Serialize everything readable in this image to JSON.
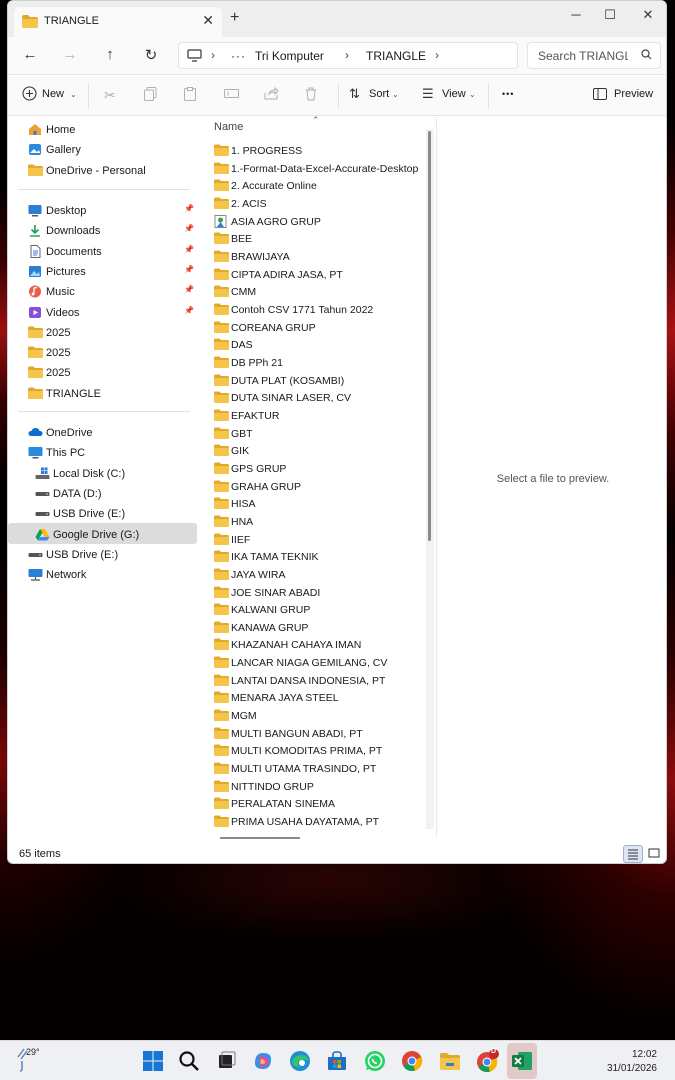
{
  "window": {
    "tab_title": "TRIANGLE",
    "new_tab_symbol": "+"
  },
  "navigation": {
    "breadcrumbs": [
      "Tri Komputer",
      "TRIANGLE"
    ],
    "more_symbol": "···",
    "search_placeholder": "Search TRIANGL"
  },
  "commandbar": {
    "new_label": "New",
    "sort_label": "Sort",
    "view_label": "View",
    "more_symbol": "•••",
    "preview_label": "Preview"
  },
  "sidebar": {
    "top": [
      {
        "label": "Home",
        "icon": "home-icon"
      },
      {
        "label": "Gallery",
        "icon": "gallery-icon"
      },
      {
        "label": "OneDrive - Personal",
        "icon": "folder-icon"
      }
    ],
    "quick_access": [
      {
        "label": "Desktop",
        "icon": "desktop-icon",
        "pinned": true
      },
      {
        "label": "Downloads",
        "icon": "download-icon",
        "pinned": true
      },
      {
        "label": "Documents",
        "icon": "documents-icon",
        "pinned": true
      },
      {
        "label": "Pictures",
        "icon": "pictures-icon",
        "pinned": true
      },
      {
        "label": "Music",
        "icon": "music-icon",
        "pinned": true
      },
      {
        "label": "Videos",
        "icon": "videos-icon",
        "pinned": true
      },
      {
        "label": "2025",
        "icon": "folder-icon",
        "pinned": false
      },
      {
        "label": "2025",
        "icon": "folder-icon",
        "pinned": false
      },
      {
        "label": "2025",
        "icon": "folder-icon",
        "pinned": false
      },
      {
        "label": "TRIANGLE",
        "icon": "folder-icon",
        "pinned": false
      }
    ],
    "tree": [
      {
        "label": "OneDrive",
        "icon": "cloud-icon",
        "indent": 0
      },
      {
        "label": "This PC",
        "icon": "pc-icon",
        "indent": 0
      },
      {
        "label": "Local Disk (C:)",
        "icon": "windows-drive-icon",
        "indent": 1
      },
      {
        "label": "DATA (D:)",
        "icon": "drive-icon",
        "indent": 1
      },
      {
        "label": "USB Drive (E:)",
        "icon": "drive-icon",
        "indent": 1
      },
      {
        "label": "Google Drive (G:)",
        "icon": "google-drive-icon",
        "indent": 1,
        "selected": true
      },
      {
        "label": "USB Drive (E:)",
        "icon": "drive-icon",
        "indent": 0
      },
      {
        "label": "Network",
        "icon": "network-icon",
        "indent": 0
      }
    ]
  },
  "filelist": {
    "column_header": "Name",
    "items": [
      "1. PROGRESS",
      "1.-Format-Data-Excel-Accurate-Desktop",
      "2. Accurate Online",
      "2. ACIS",
      "ASIA AGRO GRUP",
      "BEE",
      "BRAWIJAYA",
      "CIPTA ADIRA JASA, PT",
      "CMM",
      "Contoh CSV 1771 Tahun 2022",
      "COREANA GRUP",
      "DAS",
      "DB PPh 21",
      "DUTA PLAT (KOSAMBI)",
      "DUTA SINAR LASER, CV",
      "EFAKTUR",
      "GBT",
      "GIK",
      "GPS GRUP",
      "GRAHA GRUP",
      "HISA",
      "HNA",
      "IIEF",
      "IKA TAMA TEKNIK",
      "JAYA WIRA",
      "JOE SINAR ABADI",
      "KALWANI GRUP",
      "KANAWA GRUP",
      "KHAZANAH CAHAYA IMAN",
      "LANCAR NIAGA GEMILANG, CV",
      "LANTAI DANSA INDONESIA, PT",
      "MENARA JAYA STEEL",
      "MGM",
      "MULTI BANGUN ABADI, PT",
      "MULTI KOMODITAS PRIMA, PT",
      "MULTI UTAMA TRASINDO, PT",
      "NITTINDO GRUP",
      "PERALATAN SINEMA",
      "PRIMA USAHA DAYATAMA, PT"
    ],
    "special_icon_index": 4
  },
  "preview": {
    "message": "Select a file to preview."
  },
  "status": {
    "item_count": "65 items"
  },
  "taskbar": {
    "weather_temp": "29°",
    "time": "12:02",
    "date": "31/01/2026",
    "chrome_badge": "D"
  },
  "colors": {
    "folder": "#f4c54a",
    "folder_dark": "#e2a92a",
    "accent": "#0067c0"
  }
}
